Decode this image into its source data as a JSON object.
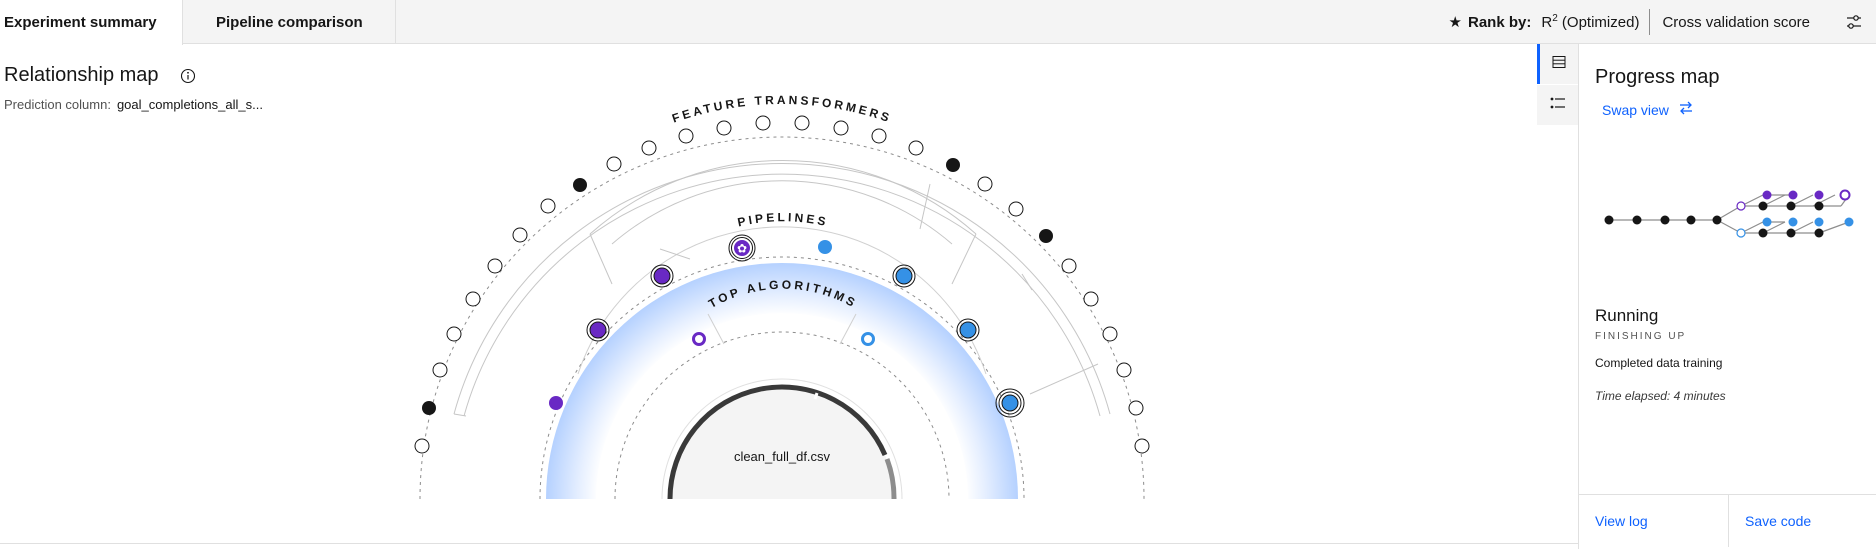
{
  "tabs": [
    {
      "label": "Experiment summary",
      "active": true
    },
    {
      "label": "Pipeline comparison",
      "active": false
    }
  ],
  "rank": {
    "label": "Rank by:",
    "metric_base": "R",
    "metric_sup": "2",
    "metric_suffix": "(Optimized)",
    "cross_validation": "Cross validation score",
    "icons": [
      "star-icon",
      "settings-adjust-icon"
    ]
  },
  "relationship_map": {
    "title": "Relationship map",
    "prediction_label": "Prediction column:",
    "prediction_value": "goal_completions_all_s...",
    "ring_labels": {
      "feature_transformers": "FEATURE TRANSFORMERS",
      "pipelines": "PIPELINES",
      "top_algorithms": "TOP ALGORITHMS"
    },
    "center_label": "clean_full_df.csv"
  },
  "colors": {
    "purple": "#6929c4",
    "blue": "#3591e6",
    "black": "#161616",
    "accent": "#0f62fe",
    "glow": "#c5dcff"
  },
  "progress": {
    "title": "Progress map",
    "swap_label": "Swap view",
    "status": "Running",
    "status_sub": "FINISHING UP",
    "description": "Completed data training",
    "elapsed": "Time elapsed: 4 minutes"
  },
  "footer": {
    "view_log": "View log",
    "save_code": "Save code"
  }
}
